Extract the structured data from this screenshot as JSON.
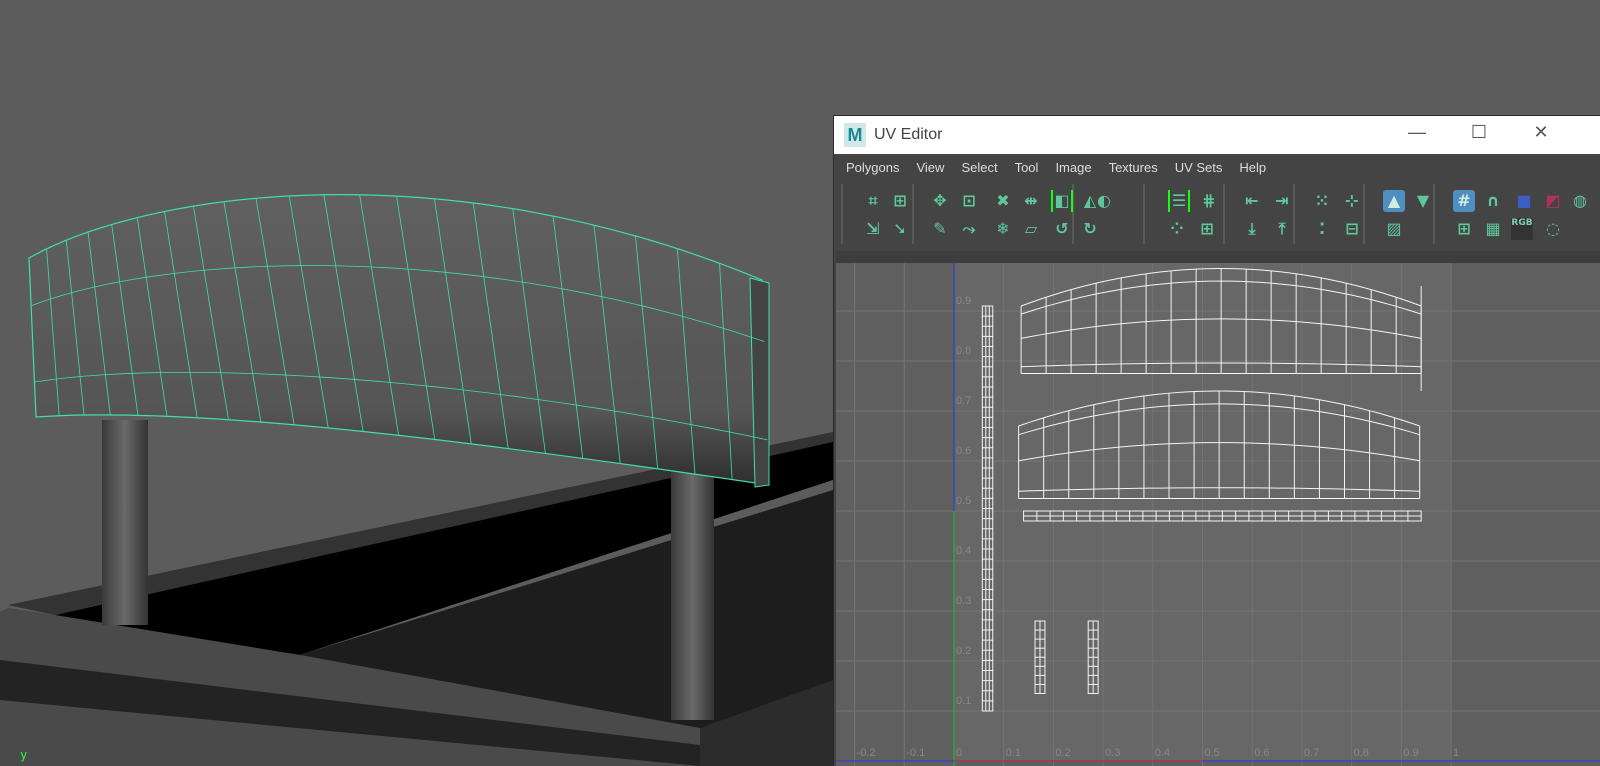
{
  "viewport": {
    "axis_label": "y"
  },
  "window": {
    "title": "UV Editor",
    "logo": "M",
    "minimize": "—",
    "maximize": "☐",
    "close": "✕"
  },
  "menu": [
    "Polygons",
    "View",
    "Select",
    "Tool",
    "Image",
    "Textures",
    "UV Sets",
    "Help"
  ],
  "toolbar": {
    "rgb_label": "RGB",
    "icons": [
      {
        "name": "cut-uv-icon",
        "g": "⌗"
      },
      {
        "name": "unfold-icon",
        "g": "⊞"
      },
      {
        "name": "select-edge-loop-icon",
        "g": "⇲"
      },
      {
        "name": "select-shell-icon",
        "g": "➘"
      },
      {
        "name": "move-sew-icon",
        "g": "✥"
      },
      {
        "name": "create-uv-icon",
        "g": "⊡"
      },
      {
        "name": "cut-tool-icon",
        "g": "✎"
      },
      {
        "name": "tweak-icon",
        "g": "⤳"
      },
      {
        "name": "unfold-x-icon",
        "g": "✖"
      },
      {
        "name": "freeze-icon",
        "g": "❄"
      },
      {
        "name": "sew-icon",
        "g": "⇹"
      },
      {
        "name": "distort-icon",
        "g": "▱"
      },
      {
        "name": "symmetrize-icon",
        "g": "◧"
      },
      {
        "name": "flip-icon",
        "g": "◭"
      },
      {
        "name": "rotate-icon",
        "g": "◐"
      },
      {
        "name": "rotate-ccw-icon",
        "g": "↺"
      },
      {
        "name": "rotate-cw-icon",
        "g": "↻"
      },
      {
        "name": "layout-icon",
        "g": "☰"
      },
      {
        "name": "grid-icon",
        "g": "⋕"
      },
      {
        "name": "stack-icon",
        "g": "⁘"
      },
      {
        "name": "gather-icon",
        "g": "⊞"
      },
      {
        "name": "align-left-icon",
        "g": "⇤"
      },
      {
        "name": "align-right-icon",
        "g": "⇥"
      },
      {
        "name": "align-bottom-icon",
        "g": "⤓"
      },
      {
        "name": "align-top-icon",
        "g": "⤒"
      },
      {
        "name": "shell-select-icon",
        "g": "⁙"
      },
      {
        "name": "grow-select-icon",
        "g": "⊹"
      },
      {
        "name": "shell-grow-icon",
        "g": "⁚"
      },
      {
        "name": "shrink-select-icon",
        "g": "⊟"
      },
      {
        "name": "display-image-icon",
        "g": "▲"
      },
      {
        "name": "filter-icon",
        "g": "▼"
      },
      {
        "name": "dim-image-icon",
        "g": "▨"
      },
      {
        "name": "grid-display-icon",
        "g": "#"
      },
      {
        "name": "snap-icon",
        "g": "∩"
      },
      {
        "name": "shaded-icon",
        "g": "■"
      },
      {
        "name": "distortion-icon",
        "g": "◩"
      },
      {
        "name": "more-icon",
        "g": "◍"
      },
      {
        "name": "texture-borders-icon",
        "g": "⊞"
      },
      {
        "name": "checker-icon",
        "g": "▦"
      },
      {
        "name": "color-wheel-icon",
        "g": "◕"
      },
      {
        "name": "exposure-icon",
        "g": "◌"
      }
    ]
  },
  "axes": {
    "u": [
      "-0.2",
      "-0.1",
      "0",
      "0.1",
      "0.2",
      "0.3",
      "0.4",
      "0.5",
      "0.6",
      "0.7",
      "0.8",
      "0.9",
      "1"
    ],
    "v": [
      "0.1",
      "0.2",
      "0.3",
      "0.4",
      "0.5",
      "0.6",
      "0.7",
      "0.8",
      "0.9"
    ]
  },
  "colors": {
    "accent": "#5fc79e",
    "wire": "#3fe0a0",
    "active": "#4f8fbf"
  }
}
